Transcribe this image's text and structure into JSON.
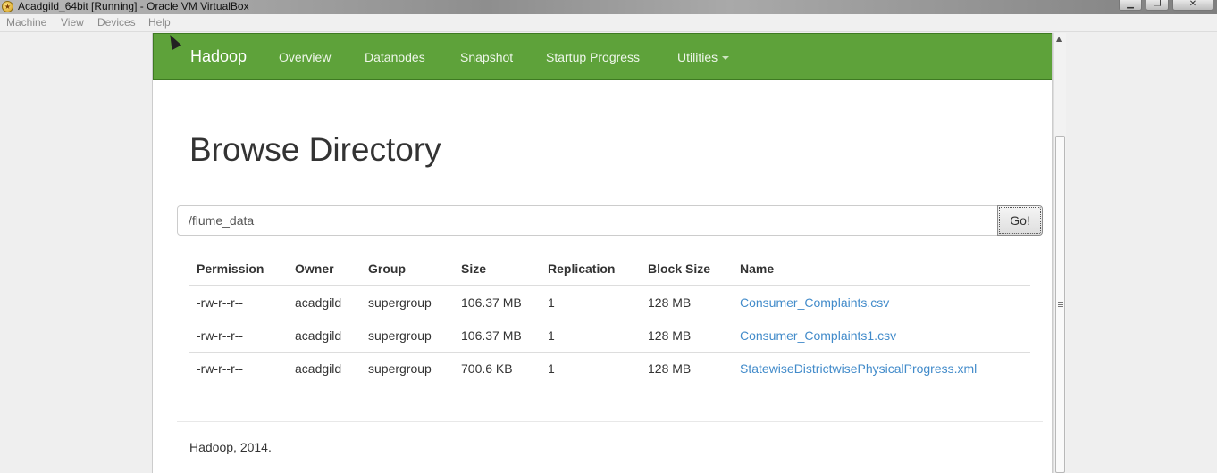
{
  "window": {
    "title": "Acadgild_64bit [Running] - Oracle VM VirtualBox",
    "menu": [
      "Machine",
      "View",
      "Devices",
      "Help"
    ],
    "controls": {
      "minimize": "▁",
      "restore": "❐",
      "close": "✕"
    }
  },
  "navbar": {
    "brand": "Hadoop",
    "items": [
      "Overview",
      "Datanodes",
      "Snapshot",
      "Startup Progress",
      "Utilities"
    ],
    "color": "#5ea23a"
  },
  "page": {
    "title": "Browse Directory",
    "path_value": "/flume_data",
    "go_label": "Go!"
  },
  "table": {
    "headers": [
      "Permission",
      "Owner",
      "Group",
      "Size",
      "Replication",
      "Block Size",
      "Name"
    ],
    "rows": [
      [
        "-rw-r--r--",
        "acadgild",
        "supergroup",
        "106.37 MB",
        "1",
        "128 MB",
        "Consumer_Complaints.csv"
      ],
      [
        "-rw-r--r--",
        "acadgild",
        "supergroup",
        "106.37 MB",
        "1",
        "128 MB",
        "Consumer_Complaints1.csv"
      ],
      [
        "-rw-r--r--",
        "acadgild",
        "supergroup",
        "700.6 KB",
        "1",
        "128 MB",
        "StatewiseDistrictwisePhysicalProgress.xml"
      ]
    ]
  },
  "footer": "Hadoop, 2014.",
  "icons": {
    "app": "virtualbox-icon",
    "scroll_up": "▲"
  }
}
